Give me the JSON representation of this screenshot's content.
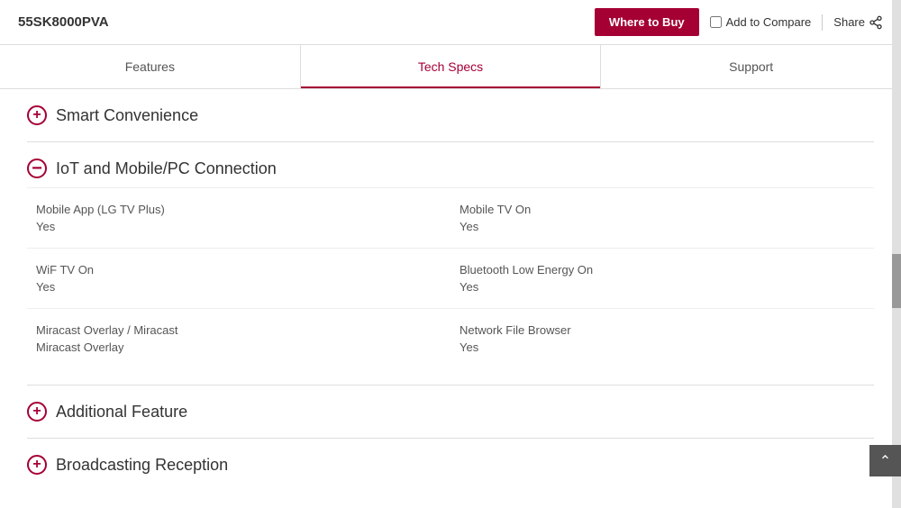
{
  "header": {
    "model_name": "55SK8000PVA",
    "where_to_buy_label": "Where to Buy",
    "add_compare_label": "Add to Compare",
    "share_label": "Share"
  },
  "nav": {
    "tabs": [
      {
        "id": "features",
        "label": "Features",
        "active": false
      },
      {
        "id": "tech-specs",
        "label": "Tech Specs",
        "active": true
      },
      {
        "id": "support",
        "label": "Support",
        "active": false
      }
    ]
  },
  "sections": [
    {
      "id": "smart-convenience",
      "title": "Smart Convenience",
      "collapsed": true,
      "toggle": "plus",
      "rows": []
    },
    {
      "id": "iot-mobile-pc",
      "title": "IoT and Mobile/PC Connection",
      "collapsed": false,
      "toggle": "minus",
      "rows": [
        {
          "left_label": "Mobile App (LG TV Plus)",
          "left_value": "Yes",
          "right_label": "Mobile TV On",
          "right_value": "Yes"
        },
        {
          "left_label": "WiF TV On",
          "left_value": "Yes",
          "right_label": "Bluetooth Low Energy On",
          "right_value": "Yes"
        },
        {
          "left_label": "Miracast Overlay / Miracast",
          "left_value": "Miracast Overlay",
          "right_label": "Network File Browser",
          "right_value": "Yes"
        }
      ]
    },
    {
      "id": "additional-feature",
      "title": "Additional Feature",
      "collapsed": true,
      "toggle": "plus",
      "rows": []
    },
    {
      "id": "broadcasting-reception",
      "title": "Broadcasting Reception",
      "collapsed": true,
      "toggle": "plus",
      "rows": []
    }
  ]
}
